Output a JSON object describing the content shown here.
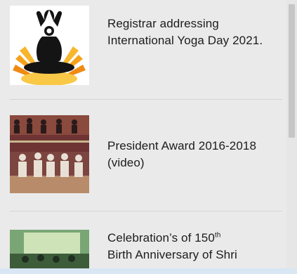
{
  "news": [
    {
      "title": "Registrar addressing International Yoga Day 2021.",
      "thumbnail": "yoga-day-logo-image"
    },
    {
      "title": "President Award 2016-2018 (video)",
      "thumbnail": "award-ceremony-photo"
    },
    {
      "title_main": "Celebration’s of 150",
      "title_sup": "th",
      "title_rest": "Birth Anniversary of Shri",
      "thumbnail": "celebration-event-photo"
    }
  ],
  "colors": {
    "background": "#eaeaea",
    "text": "#1c1c1c",
    "divider": "#d4d4d4",
    "scrollbar_thumb": "#c6c6c6"
  }
}
